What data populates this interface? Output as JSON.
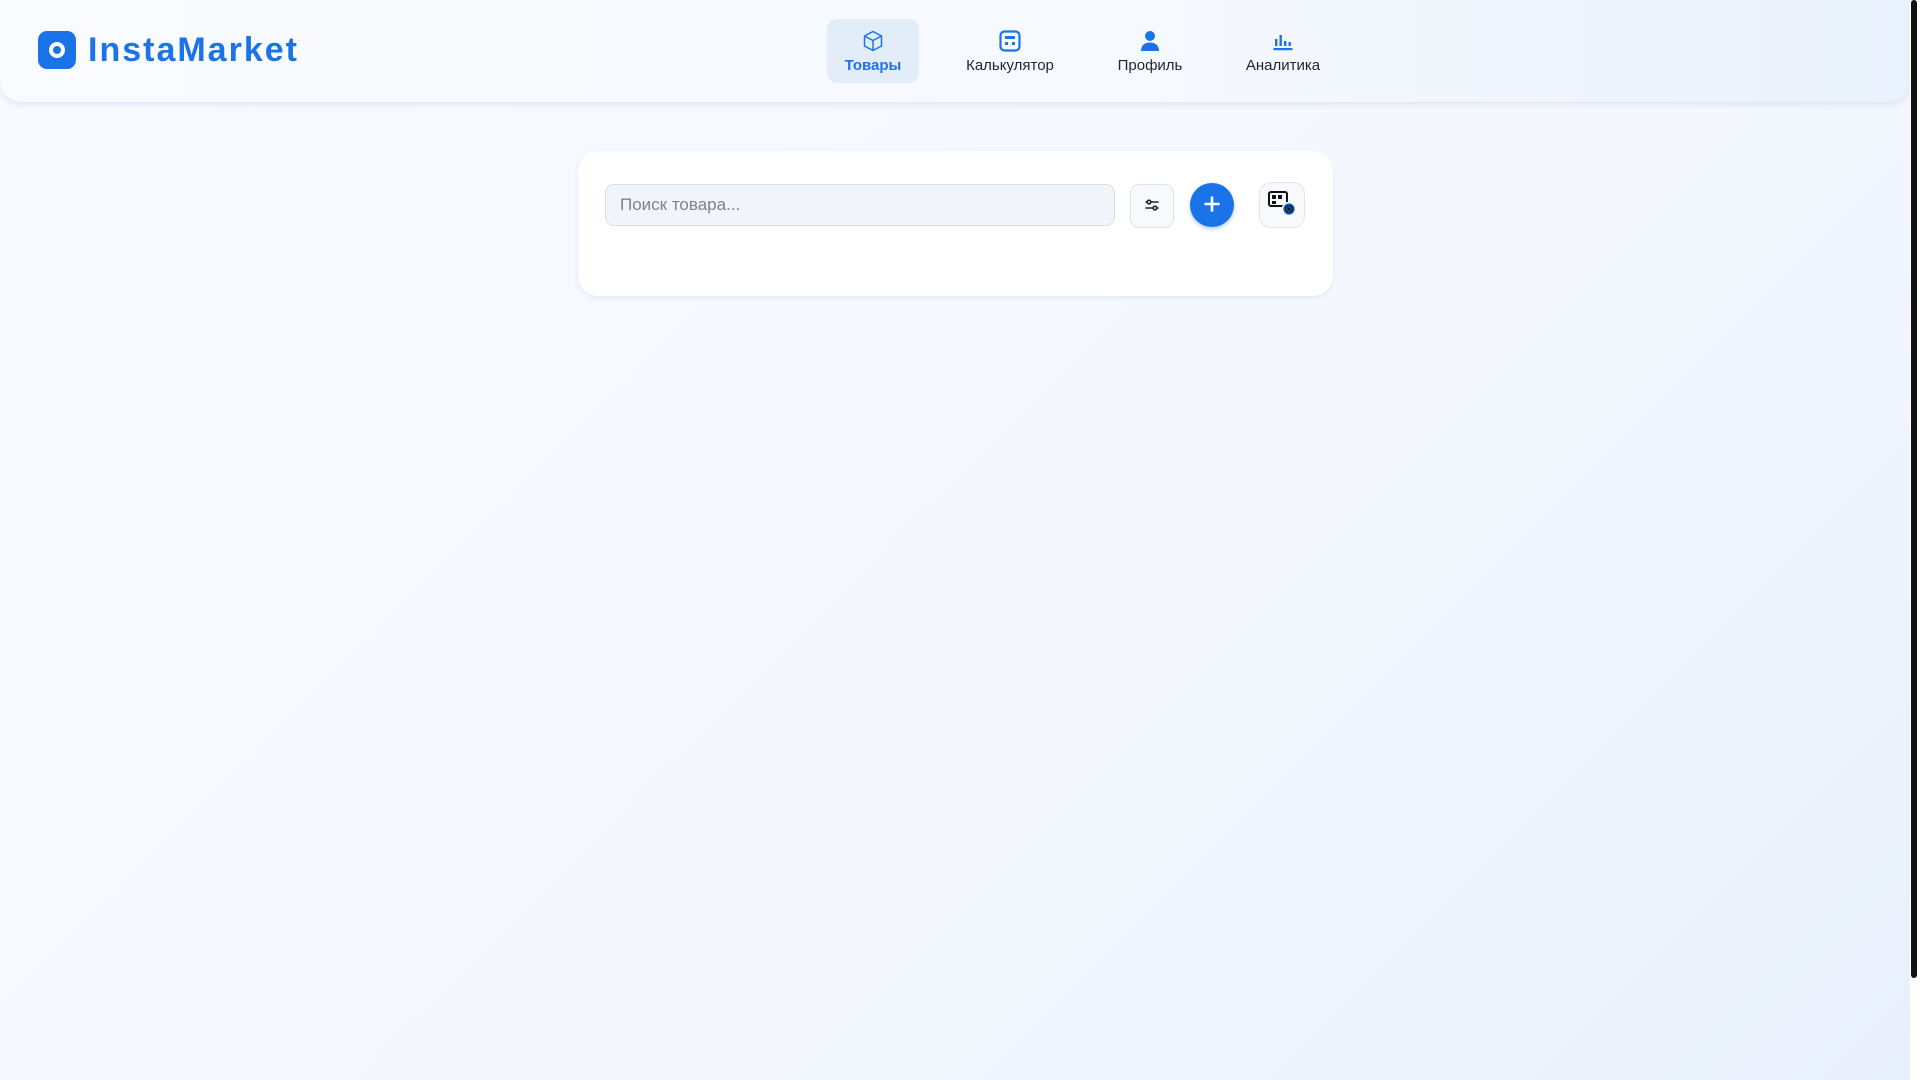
{
  "app": {
    "name": "InstaMarket",
    "brand_color": "#1a73e8"
  },
  "nav": {
    "items": [
      {
        "label": "Товары",
        "icon": "box-icon",
        "active": true
      },
      {
        "label": "Калькулятор",
        "icon": "calculator-icon",
        "active": false
      },
      {
        "label": "Профиль",
        "icon": "user-icon",
        "active": false
      },
      {
        "label": "Аналитика",
        "icon": "bar-chart-icon",
        "active": false
      }
    ]
  },
  "toolbar": {
    "search_placeholder": "Поиск товара...",
    "search_value": "",
    "filter_icon": "sliders-icon",
    "add_icon": "plus-icon",
    "barcode_icon": "barcode-scan-icon"
  }
}
